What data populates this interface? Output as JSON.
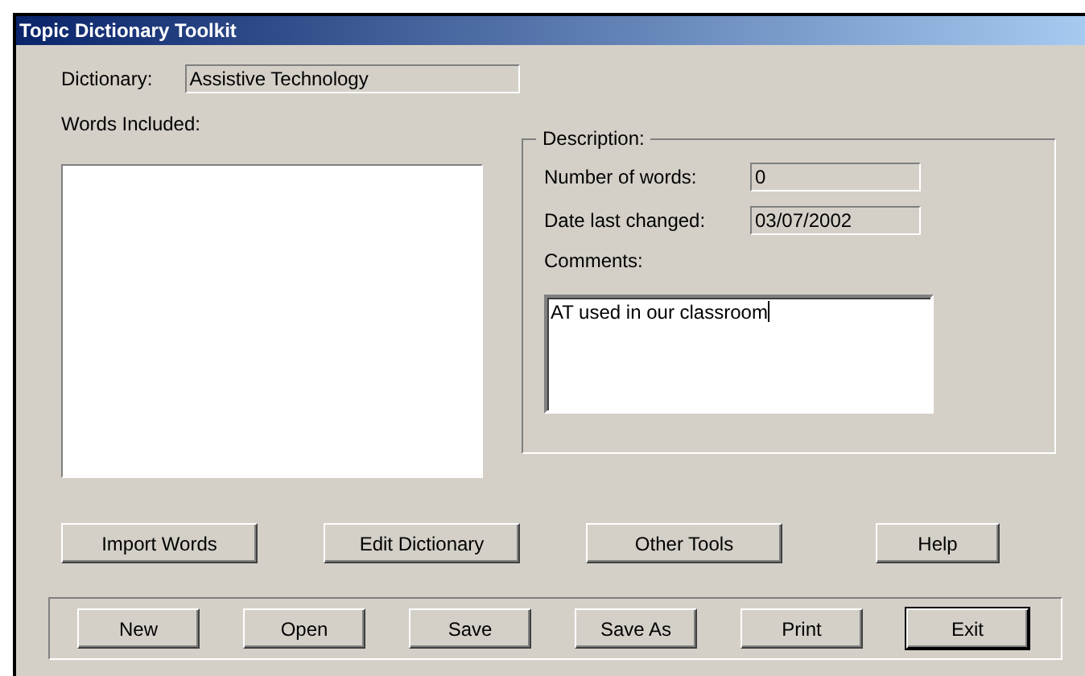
{
  "window": {
    "title": "Topic Dictionary Toolkit"
  },
  "dictionary": {
    "label": "Dictionary:",
    "value": "Assistive Technology"
  },
  "words_included": {
    "label": "Words Included:"
  },
  "description": {
    "title": "Description:",
    "fields": [
      {
        "label": "Number of words:",
        "value": "0"
      },
      {
        "label": "Date last changed:",
        "value": "03/07/2002"
      }
    ],
    "comments": {
      "label": "Comments:",
      "value": "AT used in our classroom",
      "focused": true
    }
  },
  "tool_buttons": [
    {
      "label": "Import Words"
    },
    {
      "label": "Edit Dictionary"
    },
    {
      "label": "Other Tools"
    },
    {
      "label": "Help"
    }
  ],
  "file_buttons": [
    {
      "label": "New",
      "default": false
    },
    {
      "label": "Open",
      "default": false
    },
    {
      "label": "Save",
      "default": false
    },
    {
      "label": "Save As",
      "default": false
    },
    {
      "label": "Print",
      "default": false
    },
    {
      "label": "Exit",
      "default": true
    }
  ]
}
